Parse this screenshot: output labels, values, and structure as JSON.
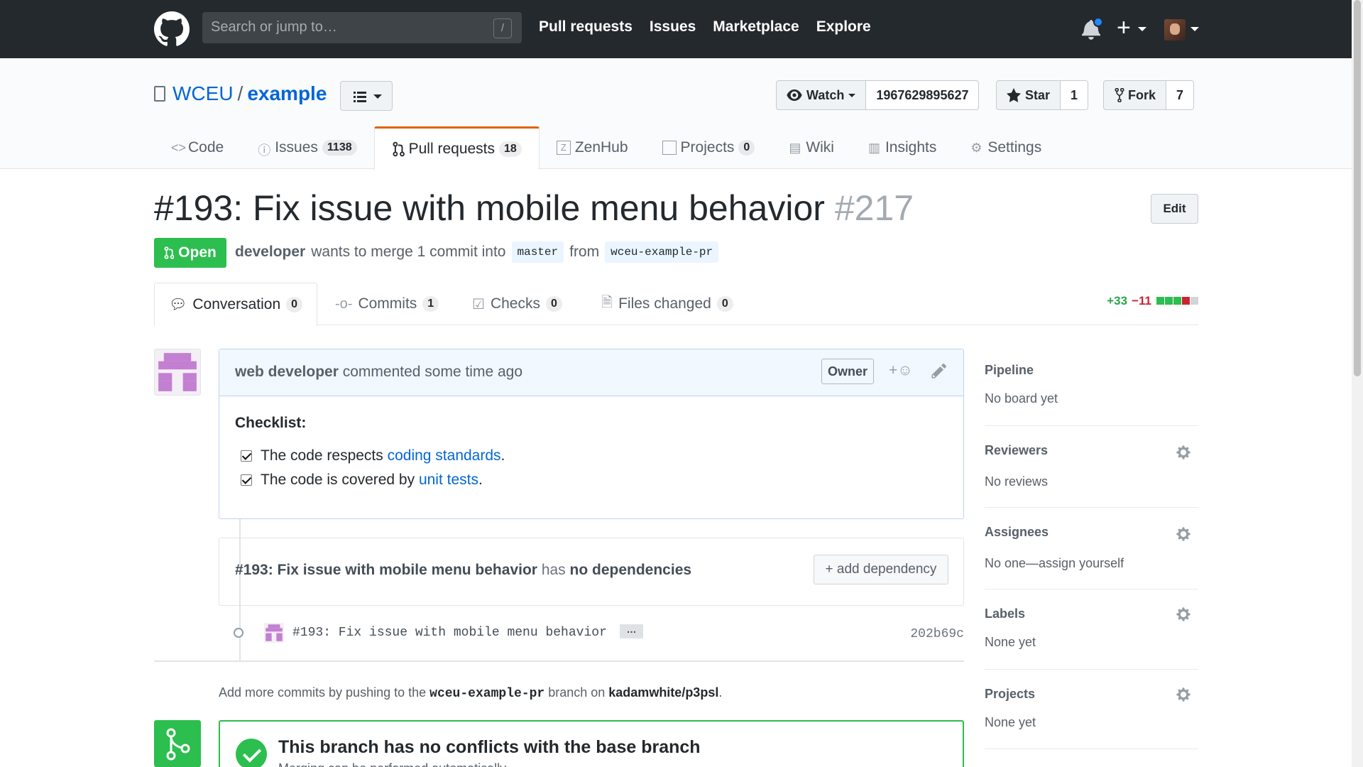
{
  "header": {
    "search_placeholder": "Search or jump to…",
    "search_shortcut": "/",
    "nav": [
      "Pull requests",
      "Issues",
      "Marketplace",
      "Explore"
    ],
    "plus_label": "+"
  },
  "repo": {
    "owner": "WCEU",
    "separator": "/",
    "name": "example",
    "watch_label": "Watch",
    "watch_count": "1967629895627",
    "star_label": "Star",
    "star_count": "1",
    "fork_label": "Fork",
    "fork_count": "7",
    "tabs": [
      {
        "label": "Code",
        "count": null
      },
      {
        "label": "Issues",
        "count": "1138"
      },
      {
        "label": "Pull requests",
        "count": "18"
      },
      {
        "label": "ZenHub",
        "count": null
      },
      {
        "label": "Projects",
        "count": "0"
      },
      {
        "label": "Wiki",
        "count": null
      },
      {
        "label": "Insights",
        "count": null
      },
      {
        "label": "Settings",
        "count": null
      }
    ]
  },
  "pr": {
    "title": "#193: Fix issue with mobile menu behavior",
    "number": "#217",
    "edit_label": "Edit",
    "state": "Open",
    "author": "developer",
    "merge_text": "wants to merge 1 commit into",
    "base_branch": "master",
    "from_text": "from",
    "head_branch": "wceu-example-pr",
    "tabs": [
      {
        "label": "Conversation",
        "count": "0"
      },
      {
        "label": "Commits",
        "count": "1"
      },
      {
        "label": "Checks",
        "count": "0"
      },
      {
        "label": "Files changed",
        "count": "0"
      }
    ],
    "additions": "+33",
    "deletions": "−11",
    "diff_blocks": [
      "#2cbe4e",
      "#2cbe4e",
      "#2cbe4e",
      "#cb2431",
      "#d1d5da"
    ]
  },
  "comment": {
    "author": "web developer",
    "action": "commented some time ago",
    "badge": "Owner",
    "reaction_label": "+☺",
    "heading": "Checklist:",
    "items": [
      {
        "before": "The code respects ",
        "link": "coding standards",
        "after": "."
      },
      {
        "before": "The code is covered by ",
        "link": "unit tests",
        "after": "."
      }
    ]
  },
  "dependency": {
    "title": "#193: Fix issue with mobile menu behavior",
    "has": "has",
    "none": "no dependencies",
    "add_label": "+ add dependency"
  },
  "commit": {
    "message": "#193: Fix issue with mobile menu behavior",
    "ellipsis": "…",
    "sha": "202b69c"
  },
  "push_note": {
    "before": "Add more commits by pushing to the",
    "branch": "wceu-example-pr",
    "middle": "branch on",
    "repo": "kadamwhite/p3psl",
    "after": "."
  },
  "merge": {
    "title": "This branch has no conflicts with the base branch",
    "subtitle": "Merging can be performed automatically."
  },
  "sidebar": [
    {
      "heading": "Pipeline",
      "value": "No board yet",
      "gear": false
    },
    {
      "heading": "Reviewers",
      "value": "No reviews",
      "gear": true
    },
    {
      "heading": "Assignees",
      "value": "No one—assign yourself",
      "gear": true
    },
    {
      "heading": "Labels",
      "value": "None yet",
      "gear": true
    },
    {
      "heading": "Projects",
      "value": "None yet",
      "gear": true
    }
  ]
}
